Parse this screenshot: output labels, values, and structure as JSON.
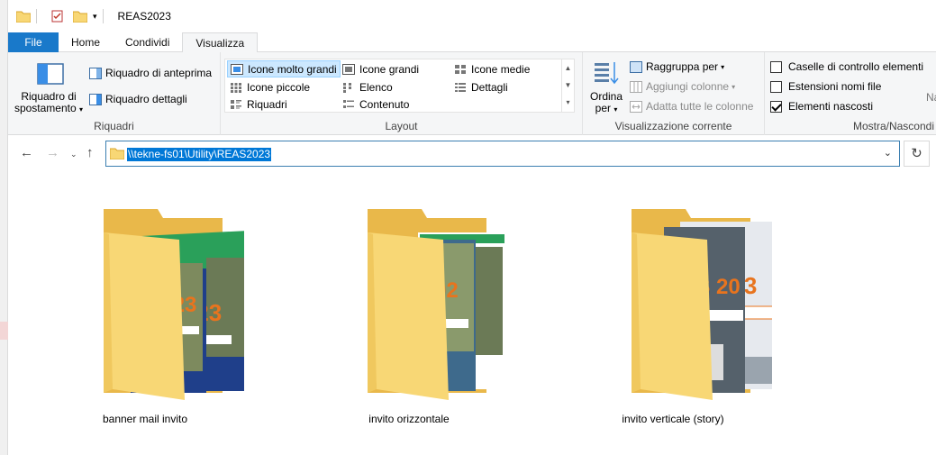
{
  "window": {
    "title": "REAS2023"
  },
  "tabs": [
    {
      "label": "File"
    },
    {
      "label": "Home"
    },
    {
      "label": "Condividi"
    },
    {
      "label": "Visualizza"
    }
  ],
  "ribbon": {
    "riquadri": {
      "label": "Riquadri",
      "navigation_pane": "Riquadro di spostamento",
      "preview_pane": "Riquadro di anteprima",
      "details_pane": "Riquadro dettagli"
    },
    "layout": {
      "label": "Layout",
      "items": [
        "Icone molto grandi",
        "Icone grandi",
        "Icone medie",
        "Icone piccole",
        "Elenco",
        "Dettagli",
        "Riquadri",
        "Contenuto"
      ],
      "selected": "Icone molto grandi"
    },
    "current_view": {
      "label": "Visualizzazione corrente",
      "sort_by": "Ordina per",
      "group_by": "Raggruppa per",
      "add_columns": "Aggiungi colonne",
      "fit_columns": "Adatta tutte le colonne"
    },
    "show_hide": {
      "label": "Mostra/Nascondi",
      "checkboxes": "Caselle di controllo elementi",
      "extensions": "Estensioni nomi file",
      "hidden_items": "Elementi nascosti",
      "cut_text": "Na"
    }
  },
  "address": {
    "path": "\\\\tekne-fs01\\Utility\\REAS2023"
  },
  "folders": [
    {
      "name": "banner mail invito"
    },
    {
      "name": "invito orizzontale"
    },
    {
      "name": "invito verticale (story)"
    }
  ],
  "colors": {
    "accent": "#1979ca",
    "selection": "#cce8ff",
    "folder": "#f8d775",
    "brand_orange": "#e8741e",
    "brand_green": "#2aa05a"
  }
}
